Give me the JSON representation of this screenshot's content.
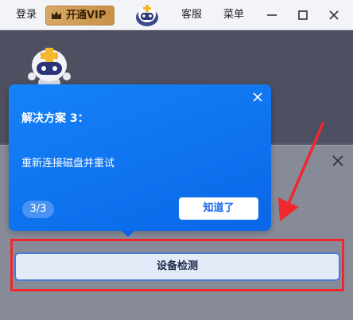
{
  "titlebar": {
    "login_label": "登录",
    "vip_label": "开通VIP",
    "service_label": "客服",
    "menu_label": "菜单"
  },
  "icons": {
    "crown": "crown-icon",
    "mascot": "mascot-icon",
    "minimize": "minimize-icon",
    "maximize": "maximize-icon",
    "close": "close-icon",
    "arrow": "arrow-icon"
  },
  "tooltip": {
    "title": "解决方案 3：",
    "body": "重新连接磁盘并重试",
    "step": "3/3",
    "confirm_label": "知道了"
  },
  "main": {
    "device_check_label": "设备检测"
  },
  "colors": {
    "tooltip_blue": "#1582f8",
    "highlight_red": "#f0272d",
    "vip_gold": "#d8a866"
  }
}
